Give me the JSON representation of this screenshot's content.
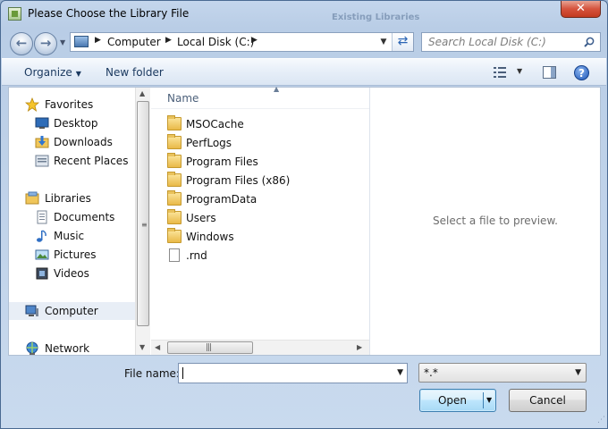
{
  "window": {
    "title": "Please Choose the Library File",
    "background_title": "Existing Libraries",
    "close_label": "✕"
  },
  "address": {
    "crumbs": [
      "Computer",
      "Local Disk (C:)"
    ],
    "search_placeholder": "Search Local Disk (C:)"
  },
  "toolbar": {
    "organize_label": "Organize",
    "new_folder_label": "New folder",
    "help_label": "?"
  },
  "nav_pane": {
    "items": [
      {
        "label": "Favorites",
        "icon": "star-icon"
      },
      {
        "label": "Desktop",
        "icon": "desktop-icon"
      },
      {
        "label": "Downloads",
        "icon": "downloads-icon"
      },
      {
        "label": "Recent Places",
        "icon": "recent-places-icon"
      },
      {
        "label": "Libraries",
        "icon": "libraries-icon"
      },
      {
        "label": "Documents",
        "icon": "documents-icon"
      },
      {
        "label": "Music",
        "icon": "music-icon"
      },
      {
        "label": "Pictures",
        "icon": "pictures-icon"
      },
      {
        "label": "Videos",
        "icon": "videos-icon"
      },
      {
        "label": "Computer",
        "icon": "computer-icon"
      },
      {
        "label": "Network",
        "icon": "network-icon"
      }
    ],
    "selected": "Computer"
  },
  "file_list": {
    "column_name": "Name",
    "items": [
      {
        "name": "MSOCache",
        "type": "folder"
      },
      {
        "name": "PerfLogs",
        "type": "folder"
      },
      {
        "name": "Program Files",
        "type": "folder"
      },
      {
        "name": "Program Files (x86)",
        "type": "folder"
      },
      {
        "name": "ProgramData",
        "type": "folder"
      },
      {
        "name": "Users",
        "type": "folder"
      },
      {
        "name": "Windows",
        "type": "folder"
      },
      {
        "name": ".rnd",
        "type": "file"
      }
    ]
  },
  "preview": {
    "text": "Select a file to preview."
  },
  "bottom": {
    "filename_label": "File name:",
    "filename_value": "",
    "filetype_value": "*.*",
    "open_label": "Open",
    "cancel_label": "Cancel"
  },
  "colors": {
    "frame": "#b9cde6",
    "selection": "#e8eef6",
    "folder": "#e9b948",
    "close_button": "#d5533d"
  }
}
